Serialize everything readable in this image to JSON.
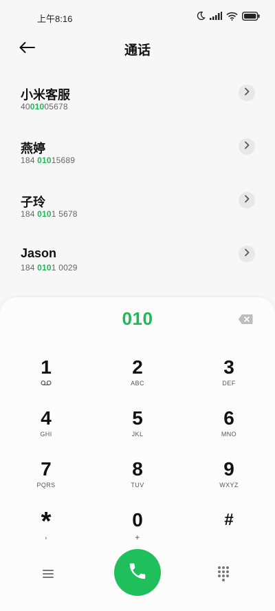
{
  "status_bar": {
    "time": "上午8:16"
  },
  "header": {
    "title": "通话"
  },
  "contacts": [
    {
      "name": "小米客服",
      "number_pre": "40",
      "number_hl": "010",
      "number_post": "05678"
    },
    {
      "name": "燕婷",
      "number_pre": "184 ",
      "number_hl": "010",
      "number_post": "15689"
    },
    {
      "name": "子玲",
      "number_pre": "184 ",
      "number_hl": "010",
      "number_post": "1 5678"
    },
    {
      "name": "Jason",
      "number_pre": "184 ",
      "number_hl": "010",
      "number_post": "1 0029"
    }
  ],
  "dialer": {
    "input": "010",
    "keys": [
      {
        "digit": "1",
        "letters": ""
      },
      {
        "digit": "2",
        "letters": "ABC"
      },
      {
        "digit": "3",
        "letters": "DEF"
      },
      {
        "digit": "4",
        "letters": "GHI"
      },
      {
        "digit": "5",
        "letters": "JKL"
      },
      {
        "digit": "6",
        "letters": "MNO"
      },
      {
        "digit": "7",
        "letters": "PQRS"
      },
      {
        "digit": "8",
        "letters": "TUV"
      },
      {
        "digit": "9",
        "letters": "WXYZ"
      },
      {
        "digit": "*",
        "letters": ","
      },
      {
        "digit": "0",
        "letters": "+"
      },
      {
        "digit": "#",
        "letters": ""
      }
    ]
  },
  "colors": {
    "accent": "#1db954",
    "call_button": "#1fbf5c"
  },
  "icons": {
    "back": "arrow-left-icon",
    "contact_arrow": "chevron-right-icon",
    "delete": "backspace-icon",
    "voicemail": "voicemail-icon",
    "menu": "menu-icon",
    "call": "phone-icon",
    "keypad": "dialpad-icon"
  }
}
